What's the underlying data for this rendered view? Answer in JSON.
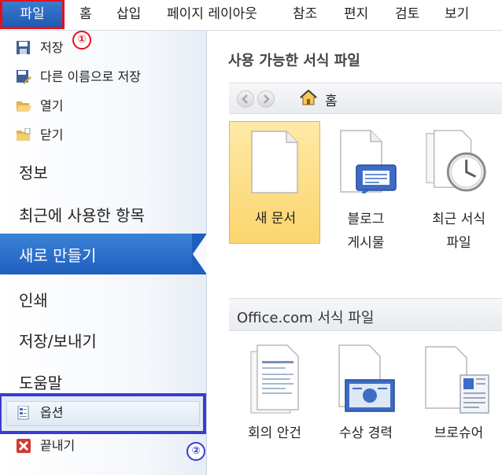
{
  "ribbon": {
    "file_tab": "파일",
    "tabs": [
      "홈",
      "삽입",
      "페이지 레이아웃",
      "참조",
      "편지",
      "검토",
      "보기"
    ]
  },
  "backstage": {
    "commands": {
      "save": "저장",
      "save_as": "다른 이름으로 저장",
      "open": "열기",
      "close": "닫기"
    },
    "sections": {
      "info": "정보",
      "recent": "최근에 사용한 항목",
      "new": "새로 만들기",
      "print": "인쇄",
      "save_send": "저장/보내기",
      "help": "도움말"
    },
    "options": "옵션",
    "exit": "끝내기"
  },
  "annotations": {
    "one": "①",
    "two": "②"
  },
  "content": {
    "available_templates_title": "사용 가능한 서식 파일",
    "nav_home": "홈",
    "templates": [
      {
        "line1": "새 문서",
        "line2": ""
      },
      {
        "line1": "블로그",
        "line2": "게시물"
      },
      {
        "line1": "최근 서식",
        "line2": "파일"
      }
    ],
    "office_section_title": "Office.com 서식 파일",
    "office_templates": [
      "회의 안건",
      "수상 경력",
      "브로슈어"
    ]
  },
  "colors": {
    "file_tab_bg": "#1e5bb4",
    "highlight_red": "#e3101c",
    "highlight_blue": "#3a3ccf",
    "selected_section_bg": "#1f5fbf",
    "selected_template_bg": "#fbd56d"
  }
}
